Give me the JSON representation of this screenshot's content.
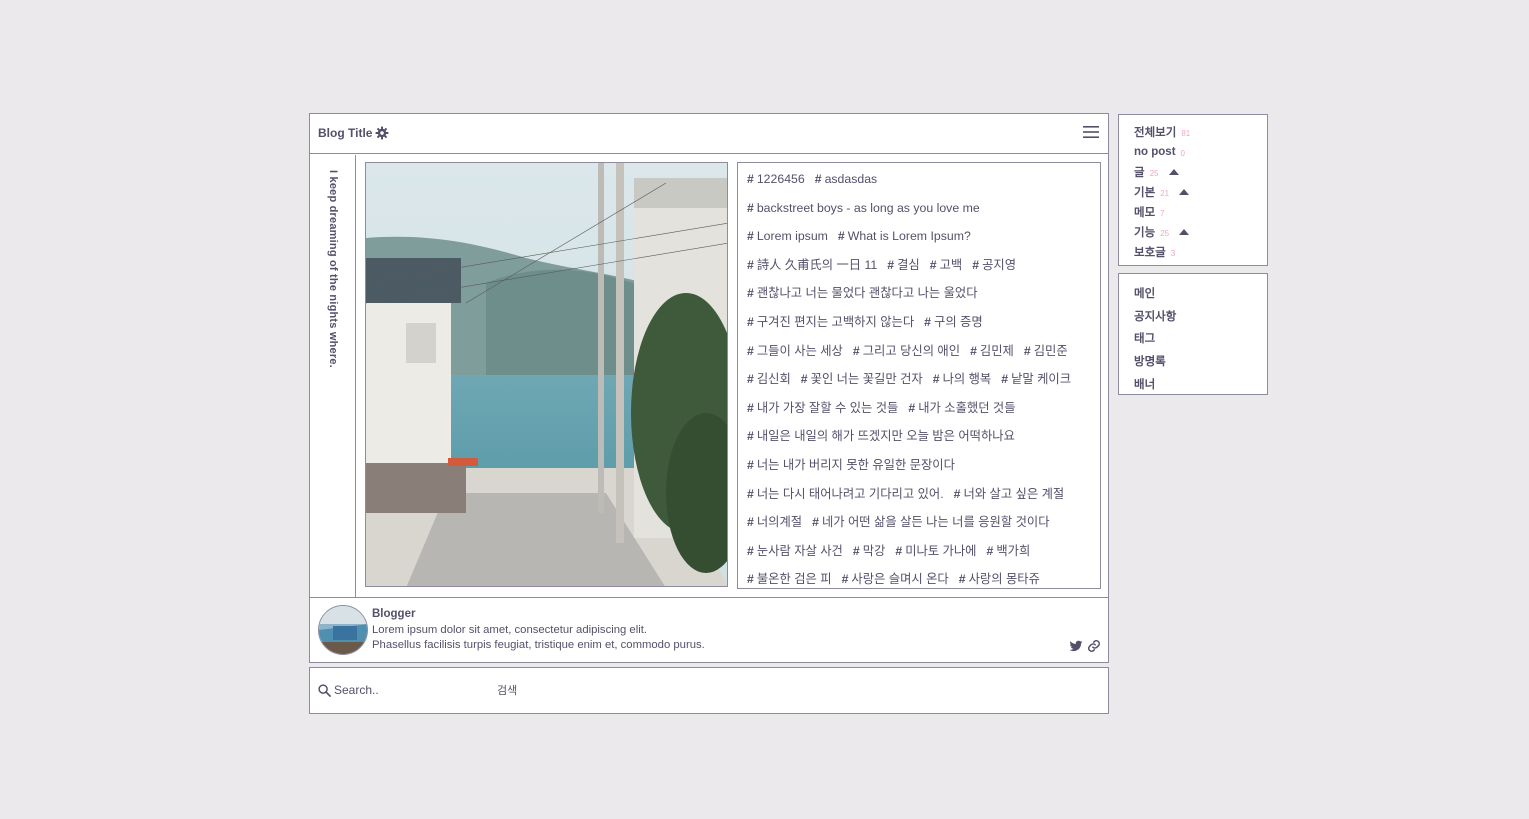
{
  "header": {
    "blog_title": "Blog Title",
    "settings_icon": "gear-icon",
    "menu_icon": "hamburger-menu-icon"
  },
  "sidebar_strip": {
    "vertical_text": "I keep dreaming of the nights where."
  },
  "tags": {
    "rows": [
      [
        "1226456",
        "asdasdas"
      ],
      [
        "backstreet boys - as long as you love me"
      ],
      [
        "Lorem ipsum",
        "What is Lorem Ipsum?"
      ],
      [
        "詩人 久甫氏의 一日 11",
        "결심",
        "고백",
        "공지영"
      ],
      [
        "괜찮나고 너는 물었다 괜찮다고 나는 울었다"
      ],
      [
        "구겨진 편지는 고백하지 않는다",
        "구의 증명"
      ],
      [
        "그들이 사는 세상",
        "그리고 당신의 애인",
        "김민제",
        "김민준"
      ],
      [
        "김신회",
        "꽃인 너는 꽃길만 건자",
        "나의 행복",
        "낱말 케이크"
      ],
      [
        "내가 가장 잘할 수 있는 것들",
        "내가 소홀했던 것들"
      ],
      [
        "내일은 내일의 해가 뜨겠지만 오늘 밤은 어떡하나요"
      ],
      [
        "너는 내가 버리지 못한 유일한 문장이다"
      ],
      [
        "너는 다시 태어나려고 기다리고 있어.",
        "너와 살고 싶은 계절"
      ],
      [
        "너의계절",
        "네가 어떤 삶을 살든 나는 너를 응원할 것이다"
      ],
      [
        "눈사람 자살 사건",
        "막강",
        "미나토 가나에",
        "백가희"
      ],
      [
        "불온한 검은 피",
        "사랑은 슬며시 온다",
        "사랑의 몽타쥬"
      ]
    ]
  },
  "profile": {
    "name": "Blogger",
    "desc_line1": "Lorem ipsum dolor sit amet, consectetur adipiscing elit.",
    "desc_line2": "Phasellus facilisis turpis feugiat, tristique enim et, commodo purus.",
    "icons": [
      "twitter-icon",
      "link-icon"
    ]
  },
  "search": {
    "placeholder": "Search..",
    "button_label": "검색"
  },
  "categories": [
    {
      "label": "전체보기",
      "count": "81",
      "expanded": false
    },
    {
      "label": "no post",
      "count": "0",
      "expanded": false
    },
    {
      "label": "글",
      "count": "25",
      "expanded": true
    },
    {
      "label": "기본",
      "count": "21",
      "expanded": true
    },
    {
      "label": "메모",
      "count": "7",
      "expanded": false
    },
    {
      "label": "기능",
      "count": "25",
      "expanded": true
    },
    {
      "label": "보호글",
      "count": "3",
      "expanded": false
    }
  ],
  "nav": [
    "메인",
    "공지사항",
    "태그",
    "방명록",
    "배너"
  ],
  "colors": {
    "background": "#ebe9ec",
    "border": "#8e8a9f",
    "text": "#55506a",
    "count": "#f2a7c3"
  }
}
